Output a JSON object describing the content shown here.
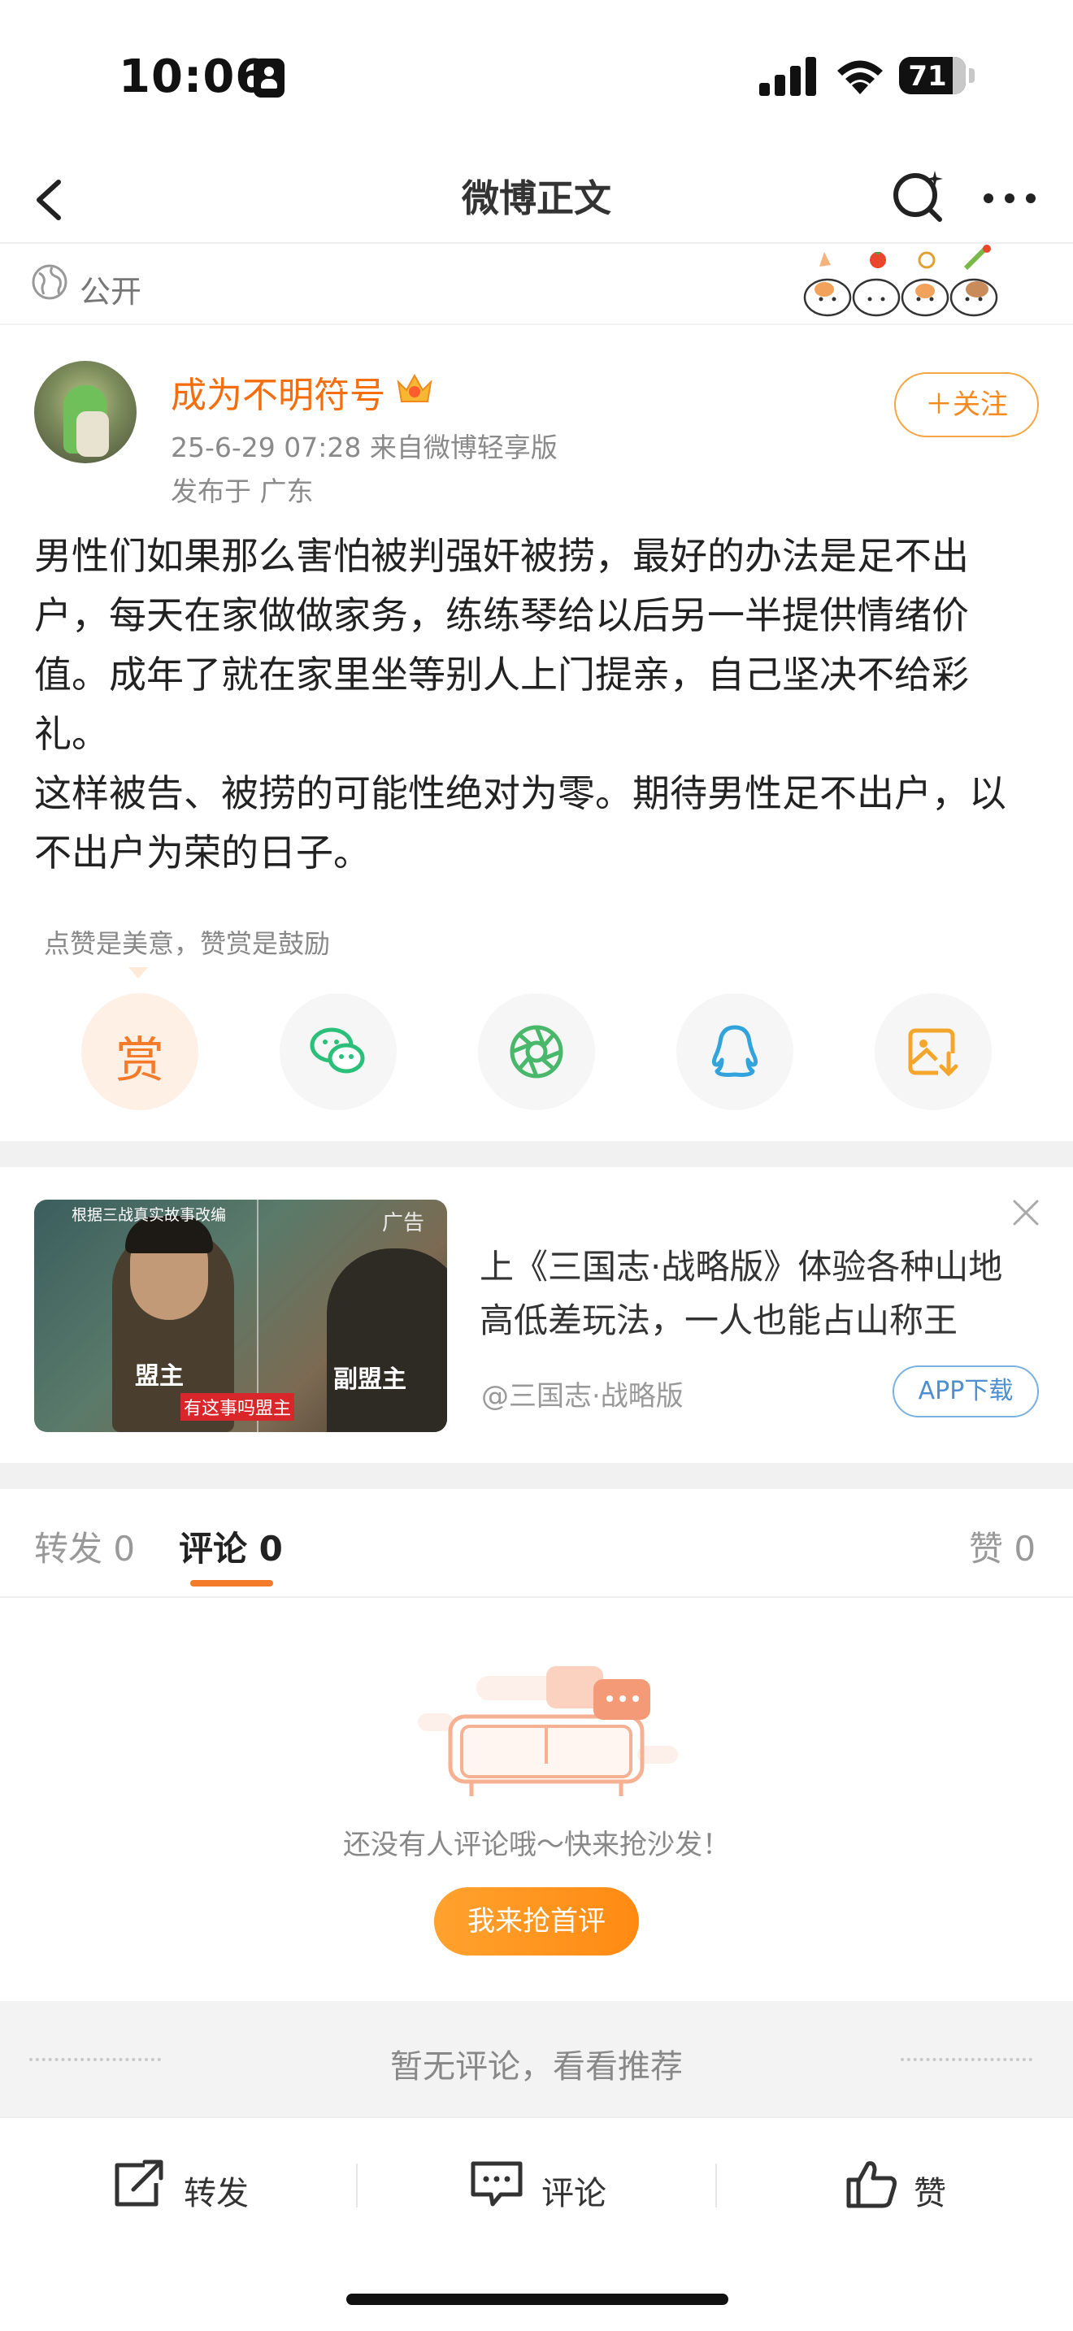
{
  "status": {
    "time": "10:06",
    "battery": "71"
  },
  "nav": {
    "title": "微博正文"
  },
  "visibility": {
    "label": "公开"
  },
  "post": {
    "author": "成为不明符号",
    "meta": "25-6-29 07:28  来自微博轻享版",
    "location": "发布于 广东",
    "follow_label": "＋关注",
    "text": "男性们如果那么害怕被判强奸被捞，最好的办法是足不出户，每天在家做做家务，练练琴给以后另一半提供情绪价值。成年了就在家里坐等别人上门提亲，自己坚决不给彩礼。\n这样被告、被捞的可能性绝对为零。期待男性足不出户，以不出户为荣的日子。"
  },
  "reward": {
    "hint": "点赞是美意，赞赏是鼓励",
    "reward_glyph": "赏",
    "buttons": [
      "reward-icon",
      "wechat-icon",
      "moments-icon",
      "qq-icon",
      "save-image-icon"
    ]
  },
  "ad": {
    "title": "上《三国志·战略版》体验各种山地高低差玩法，一人也能占山称王",
    "tag": "广告",
    "source": "@三国志·战略版",
    "button": "APP下载",
    "image_top_caption": "根据三战真实故事改编",
    "image_caption_left": "盟主",
    "image_caption_right": "副盟主",
    "image_caption_bottom": "有这事吗盟主"
  },
  "tabs": {
    "repost": "转发 0",
    "comment": "评论 0",
    "like": "赞 0"
  },
  "empty": {
    "text": "还没有人评论哦～快来抢沙发！",
    "button": "我来抢首评"
  },
  "recommend": {
    "text": "暂无评论，看看推荐"
  },
  "toolbar": {
    "repost": "转发",
    "comment": "评论",
    "like": "赞"
  },
  "colors": {
    "accent": "#f47b2a",
    "author": "#f46d0e",
    "link_blue": "#4d8fd0",
    "wechat": "#2ac07a",
    "moments": "#49b86b",
    "qq": "#33a3dc",
    "save": "#f4a52b"
  }
}
